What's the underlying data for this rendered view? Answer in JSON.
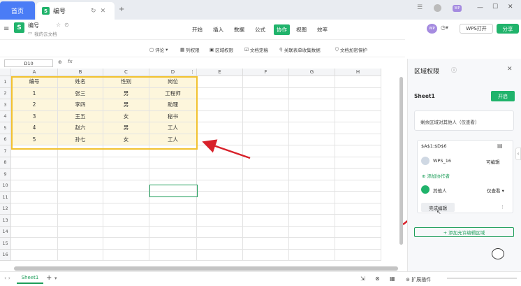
{
  "tabs": {
    "home": "首页",
    "doc": "编号"
  },
  "doc": {
    "title": "编号",
    "location": "我的云文档"
  },
  "menu": [
    "开始",
    "插入",
    "数据",
    "公式",
    "协作",
    "视图",
    "效率"
  ],
  "header": {
    "avatar": "WP",
    "wps_open": "WPS打开",
    "share": "分享"
  },
  "toolbar2": [
    "评论",
    "列权限",
    "区域权限",
    "文档定稿",
    "关联表单收集数据",
    "文档加密保护"
  ],
  "formula": {
    "cell": "D10",
    "fx": "fx"
  },
  "columns": [
    "A",
    "B",
    "C",
    "D",
    "E",
    "F",
    "G",
    "H"
  ],
  "rows": [
    "1",
    "2",
    "3",
    "4",
    "5",
    "6",
    "7",
    "8",
    "9",
    "10",
    "11",
    "12",
    "13",
    "14",
    "15",
    "16"
  ],
  "table": [
    [
      "编号",
      "姓名",
      "性别",
      "岗位"
    ],
    [
      "1",
      "张三",
      "男",
      "工程师"
    ],
    [
      "2",
      "李四",
      "男",
      "助理"
    ],
    [
      "3",
      "王五",
      "女",
      "秘书"
    ],
    [
      "4",
      "赵六",
      "男",
      "工人"
    ],
    [
      "5",
      "孙七",
      "女",
      "工人"
    ]
  ],
  "sheet": {
    "tab": "Sheet1",
    "add": "+"
  },
  "status": {
    "zoom": "扩展插件"
  },
  "panel": {
    "title": "区域权限",
    "sheet_label": "Sheet1",
    "open_btn": "开启",
    "desc": "剩余区域对其他人（仅查看）",
    "range": "$A$1:$D$6",
    "user1": "WPS_16",
    "user1_perm": "可编辑",
    "add_collab": "添加协作者",
    "others": "其他人",
    "others_perm": "仅查看",
    "done": "完成编辑",
    "add_area": "+ 添加允许编辑区域"
  }
}
